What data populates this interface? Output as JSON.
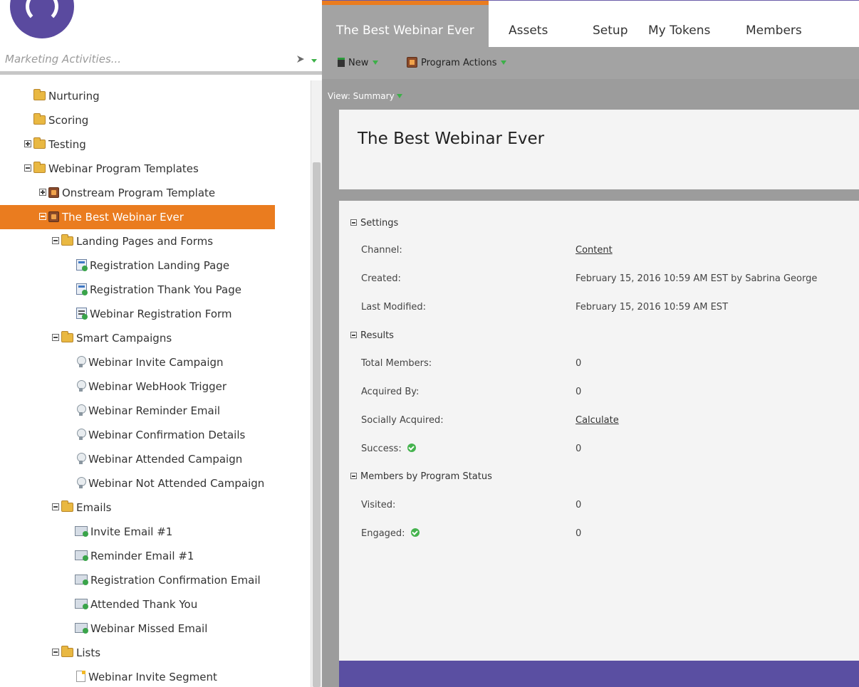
{
  "sidebar": {
    "search_placeholder": "Marketing Activities...",
    "tree": [
      {
        "label": "Nurturing",
        "icon": "folder"
      },
      {
        "label": "Scoring",
        "icon": "folder"
      },
      {
        "label": "Testing",
        "icon": "folder"
      },
      {
        "label": "Webinar Program Templates",
        "icon": "folder"
      },
      {
        "label": "Onstream Program Template",
        "icon": "program"
      },
      {
        "label": "The Best Webinar Ever",
        "icon": "program"
      },
      {
        "label": "Landing Pages and Forms",
        "icon": "folder"
      },
      {
        "label": "Registration Landing Page",
        "icon": "landing-page"
      },
      {
        "label": "Registration Thank You Page",
        "icon": "landing-page"
      },
      {
        "label": "Webinar Registration Form",
        "icon": "form"
      },
      {
        "label": "Smart Campaigns",
        "icon": "folder"
      },
      {
        "label": "Webinar Invite Campaign",
        "icon": "smart-campaign"
      },
      {
        "label": "Webinar WebHook Trigger",
        "icon": "smart-campaign"
      },
      {
        "label": "Webinar Reminder Email",
        "icon": "smart-campaign"
      },
      {
        "label": "Webinar Confirmation Details",
        "icon": "smart-campaign"
      },
      {
        "label": "Webinar Attended Campaign",
        "icon": "smart-campaign"
      },
      {
        "label": "Webinar Not Attended Campaign",
        "icon": "smart-campaign"
      },
      {
        "label": "Emails",
        "icon": "folder"
      },
      {
        "label": "Invite Email #1",
        "icon": "email"
      },
      {
        "label": "Reminder Email #1",
        "icon": "email"
      },
      {
        "label": "Registration Confirmation Email",
        "icon": "email"
      },
      {
        "label": "Attended Thank You",
        "icon": "email"
      },
      {
        "label": "Webinar Missed Email",
        "icon": "email"
      },
      {
        "label": "Lists",
        "icon": "folder"
      },
      {
        "label": "Webinar Invite Segment",
        "icon": "list"
      }
    ]
  },
  "tabs": [
    "The Best Webinar Ever",
    "Assets",
    "Setup",
    "My Tokens",
    "Members"
  ],
  "toolbar": {
    "new_label": "New",
    "actions_label": "Program Actions"
  },
  "view_label": "View: Summary",
  "program": {
    "title": "The Best Webinar Ever"
  },
  "summary": {
    "settings_title": "Settings",
    "channel_label": "Channel:",
    "channel_value": "Content",
    "created_label": "Created:",
    "created_value": "February 15, 2016 10:59 AM EST by Sabrina George",
    "modified_label": "Last Modified:",
    "modified_value": "February 15, 2016 10:59 AM EST",
    "results_title": "Results",
    "total_members_label": "Total Members:",
    "total_members_value": "0",
    "acquired_label": "Acquired By:",
    "acquired_value": "0",
    "social_label": "Socially Acquired:",
    "social_value": "Calculate",
    "success_label": "Success:",
    "success_value": "0",
    "status_title": "Members by Program Status",
    "visited_label": "Visited:",
    "visited_value": "0",
    "engaged_label": "Engaged:",
    "engaged_value": "0"
  },
  "colors": {
    "accent": "#ea7c1f",
    "brand": "#5a4fa2",
    "success": "#45b34e"
  }
}
